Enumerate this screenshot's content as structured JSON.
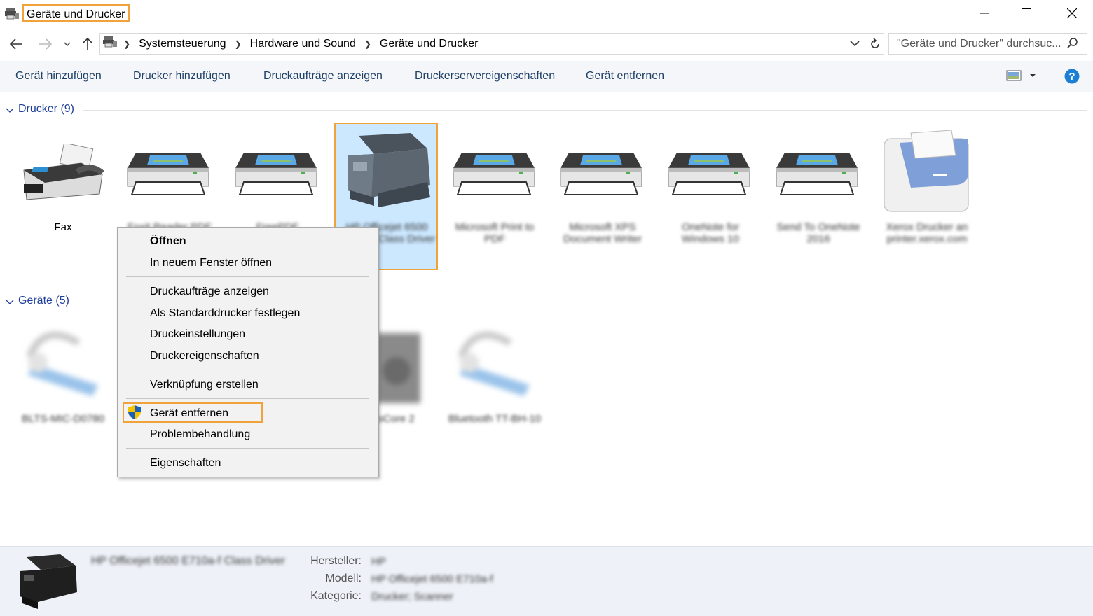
{
  "window": {
    "title": "Geräte und Drucker"
  },
  "address": {
    "crumbs": [
      "Systemsteuerung",
      "Hardware und Sound",
      "Geräte und Drucker"
    ],
    "search_placeholder": "\"Geräte und Drucker\" durchsuc..."
  },
  "toolbar": {
    "add_device": "Gerät hinzufügen",
    "add_printer": "Drucker hinzufügen",
    "show_jobs": "Druckaufträge anzeigen",
    "server_props": "Druckerservereigenschaften",
    "remove_device": "Gerät entfernen"
  },
  "groups": {
    "printers": "Drucker (9)",
    "devices": "Geräte (5)"
  },
  "printers": [
    {
      "label": "Fax",
      "blurred": false
    },
    {
      "label": "Foxit Reader PDF Printer",
      "blurred": true
    },
    {
      "label": "FreePDF",
      "blurred": true
    },
    {
      "label": "HP Officejet 6500 E710a-f Class Driver",
      "blurred": true
    },
    {
      "label": "Microsoft Print to PDF",
      "blurred": true
    },
    {
      "label": "Microsoft XPS Document Writer",
      "blurred": true
    },
    {
      "label": "OneNote for Windows 10",
      "blurred": true
    },
    {
      "label": "Send To OneNote 2016",
      "blurred": true
    },
    {
      "label": "Xerox Drucker an printer.xerox.com",
      "blurred": true
    }
  ],
  "devices": [
    {
      "label": "BLTS-MIC-D0780",
      "blurred": true
    },
    {
      "label": "AudioCore 2",
      "blurred": true
    },
    {
      "label": "Bluetooth TT-BH-10",
      "blurred": true
    }
  ],
  "context_menu": {
    "open": "Öffnen",
    "open_new_window": "In neuem Fenster öffnen",
    "show_jobs": "Druckaufträge anzeigen",
    "set_default": "Als Standarddrucker festlegen",
    "print_prefs": "Druckeinstellungen",
    "printer_props": "Druckereigenschaften",
    "create_shortcut": "Verknüpfung erstellen",
    "remove_device": "Gerät entfernen",
    "troubleshoot": "Problembehandlung",
    "properties": "Eigenschaften"
  },
  "details": {
    "name": "HP Officejet 6500 E710a-f Class Driver",
    "manufacturer_label": "Hersteller:",
    "manufacturer": "HP",
    "model_label": "Modell:",
    "model": "HP Officejet 6500 E710a-f",
    "category_label": "Kategorie:",
    "category": "Drucker; Scanner"
  },
  "colors": {
    "accent_outline": "#f0a33a",
    "selected_bg": "#cce8ff",
    "link_blue": "#1e3f9b",
    "help_blue": "#1b7fd6"
  }
}
